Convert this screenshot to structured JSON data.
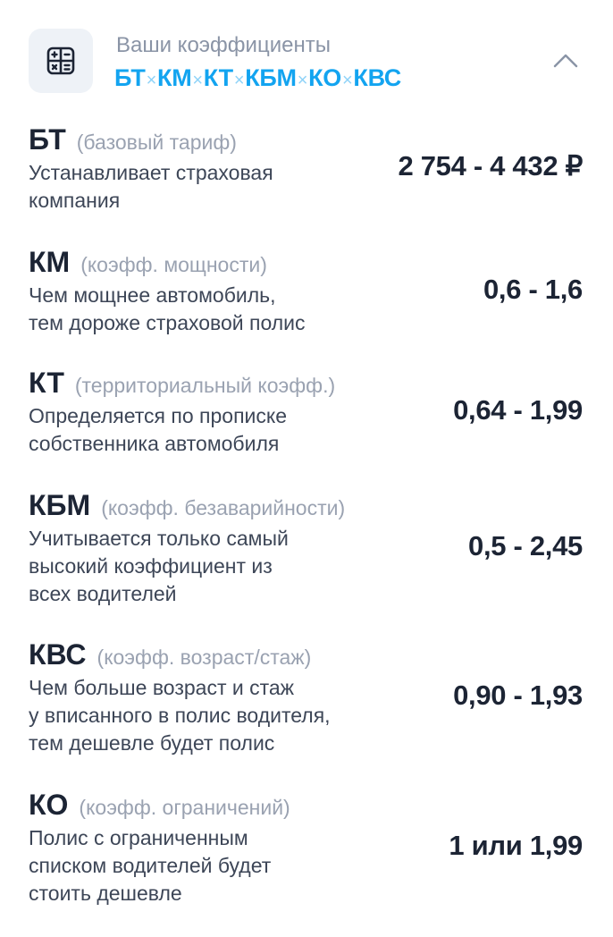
{
  "header": {
    "subtitle": "Ваши коэффициенты",
    "formula": {
      "parts": [
        "БТ",
        "КМ",
        "КТ",
        "КБМ",
        "КО",
        "КВС"
      ],
      "separator": "×"
    },
    "icon": "calculator-icon",
    "toggle_icon": "chevron-up-icon"
  },
  "coefficients": [
    {
      "abbr": "БТ",
      "full": "(базовый тариф)",
      "desc": "Устанавливает страховая\nкомпания",
      "value": "2 754 - 4 432 ₽"
    },
    {
      "abbr": "КМ",
      "full": "(коэфф. мощности)",
      "desc": "Чем мощнее автомобиль,\nтем дороже страховой полис",
      "value": "0,6 - 1,6"
    },
    {
      "abbr": "КТ",
      "full": "(территориальный коэфф.)",
      "desc": "Определяется по прописке\nсобственника автомобиля",
      "value": "0,64 - 1,99"
    },
    {
      "abbr": "КБМ",
      "full": "(коэфф. безаварийности)",
      "desc": "Учитывается только самый\nвысокий коэффициент из\nвсех водителей",
      "value": "0,5 - 2,45"
    },
    {
      "abbr": "КВС",
      "full": "(коэфф. возраст/стаж)",
      "desc": "Чем больше возраст и стаж\nу вписанного в полис водителя,\nтем дешевле будет полис",
      "value": "0,90 - 1,93"
    },
    {
      "abbr": "КО",
      "full": "(коэфф. ограничений)",
      "desc": "Полис с ограниченным\nсписком водителей будет\nстоить дешевле",
      "value": "1 или 1,99"
    }
  ],
  "colors": {
    "accent": "#13a4f0",
    "text_dark": "#1c2434",
    "text_muted": "#9aa2b1",
    "icon_bg": "#eef2f7"
  }
}
